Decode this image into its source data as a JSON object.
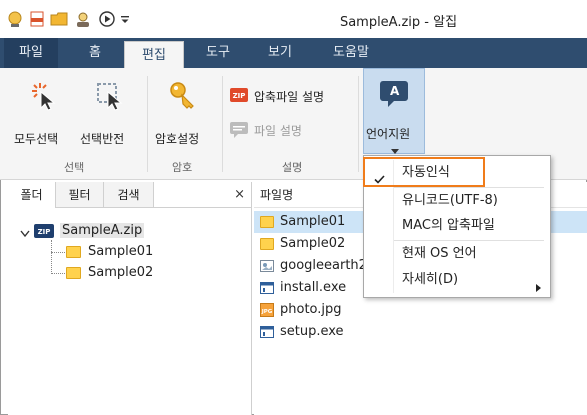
{
  "window": {
    "title": "SampleA.zip - 알집"
  },
  "quick_access": [
    "app-icon",
    "new-archive-icon",
    "open-folder-icon",
    "user-icon",
    "play-icon",
    "customize-arrow"
  ],
  "menu_tabs": [
    {
      "label": "파일",
      "active": false
    },
    {
      "label": "홈",
      "active": false
    },
    {
      "label": "편집",
      "active": true
    },
    {
      "label": "도구",
      "active": false
    },
    {
      "label": "보기",
      "active": false
    },
    {
      "label": "도움말",
      "active": false
    }
  ],
  "ribbon": {
    "select_all": "모두선택",
    "invert_select": "선택반전",
    "group_select": "선택",
    "password_set": "암호설정",
    "group_password": "암호",
    "archive_desc": "압축파일 설명",
    "file_desc": "파일 설명",
    "group_desc": "설명",
    "language_support": "언어지원",
    "language_icon_letter": "A"
  },
  "left_pane": {
    "tabs": [
      "폴더",
      "필터",
      "검색"
    ],
    "close": "×",
    "tree": [
      {
        "label": "SampleA.zip"
      },
      {
        "label": "Sample01"
      },
      {
        "label": "Sample02"
      }
    ]
  },
  "right_pane": {
    "column": "파일명",
    "files": [
      {
        "name": "Sample01",
        "type": "folder",
        "selected": true
      },
      {
        "name": "Sample02",
        "type": "folder",
        "selected": false
      },
      {
        "name": "googleearth2",
        "type": "image",
        "selected": false
      },
      {
        "name": "install.exe",
        "type": "exe",
        "selected": false
      },
      {
        "name": "photo.jpg",
        "type": "jpg",
        "selected": false
      },
      {
        "name": "setup.exe",
        "type": "exe",
        "selected": false
      }
    ]
  },
  "dropdown": {
    "items": [
      {
        "label": "자동인식",
        "checked": true
      },
      {
        "label": "유니코드(UTF-8)",
        "checked": false
      },
      {
        "label": "MAC의 압축파일",
        "checked": false
      },
      {
        "label": "현재 OS 언어",
        "checked": false
      },
      {
        "label": "자세히(D)",
        "checked": false
      }
    ]
  },
  "colors": {
    "accent": "#2f4d6f",
    "highlight": "#f07c1a",
    "selection": "#cde4f7"
  }
}
